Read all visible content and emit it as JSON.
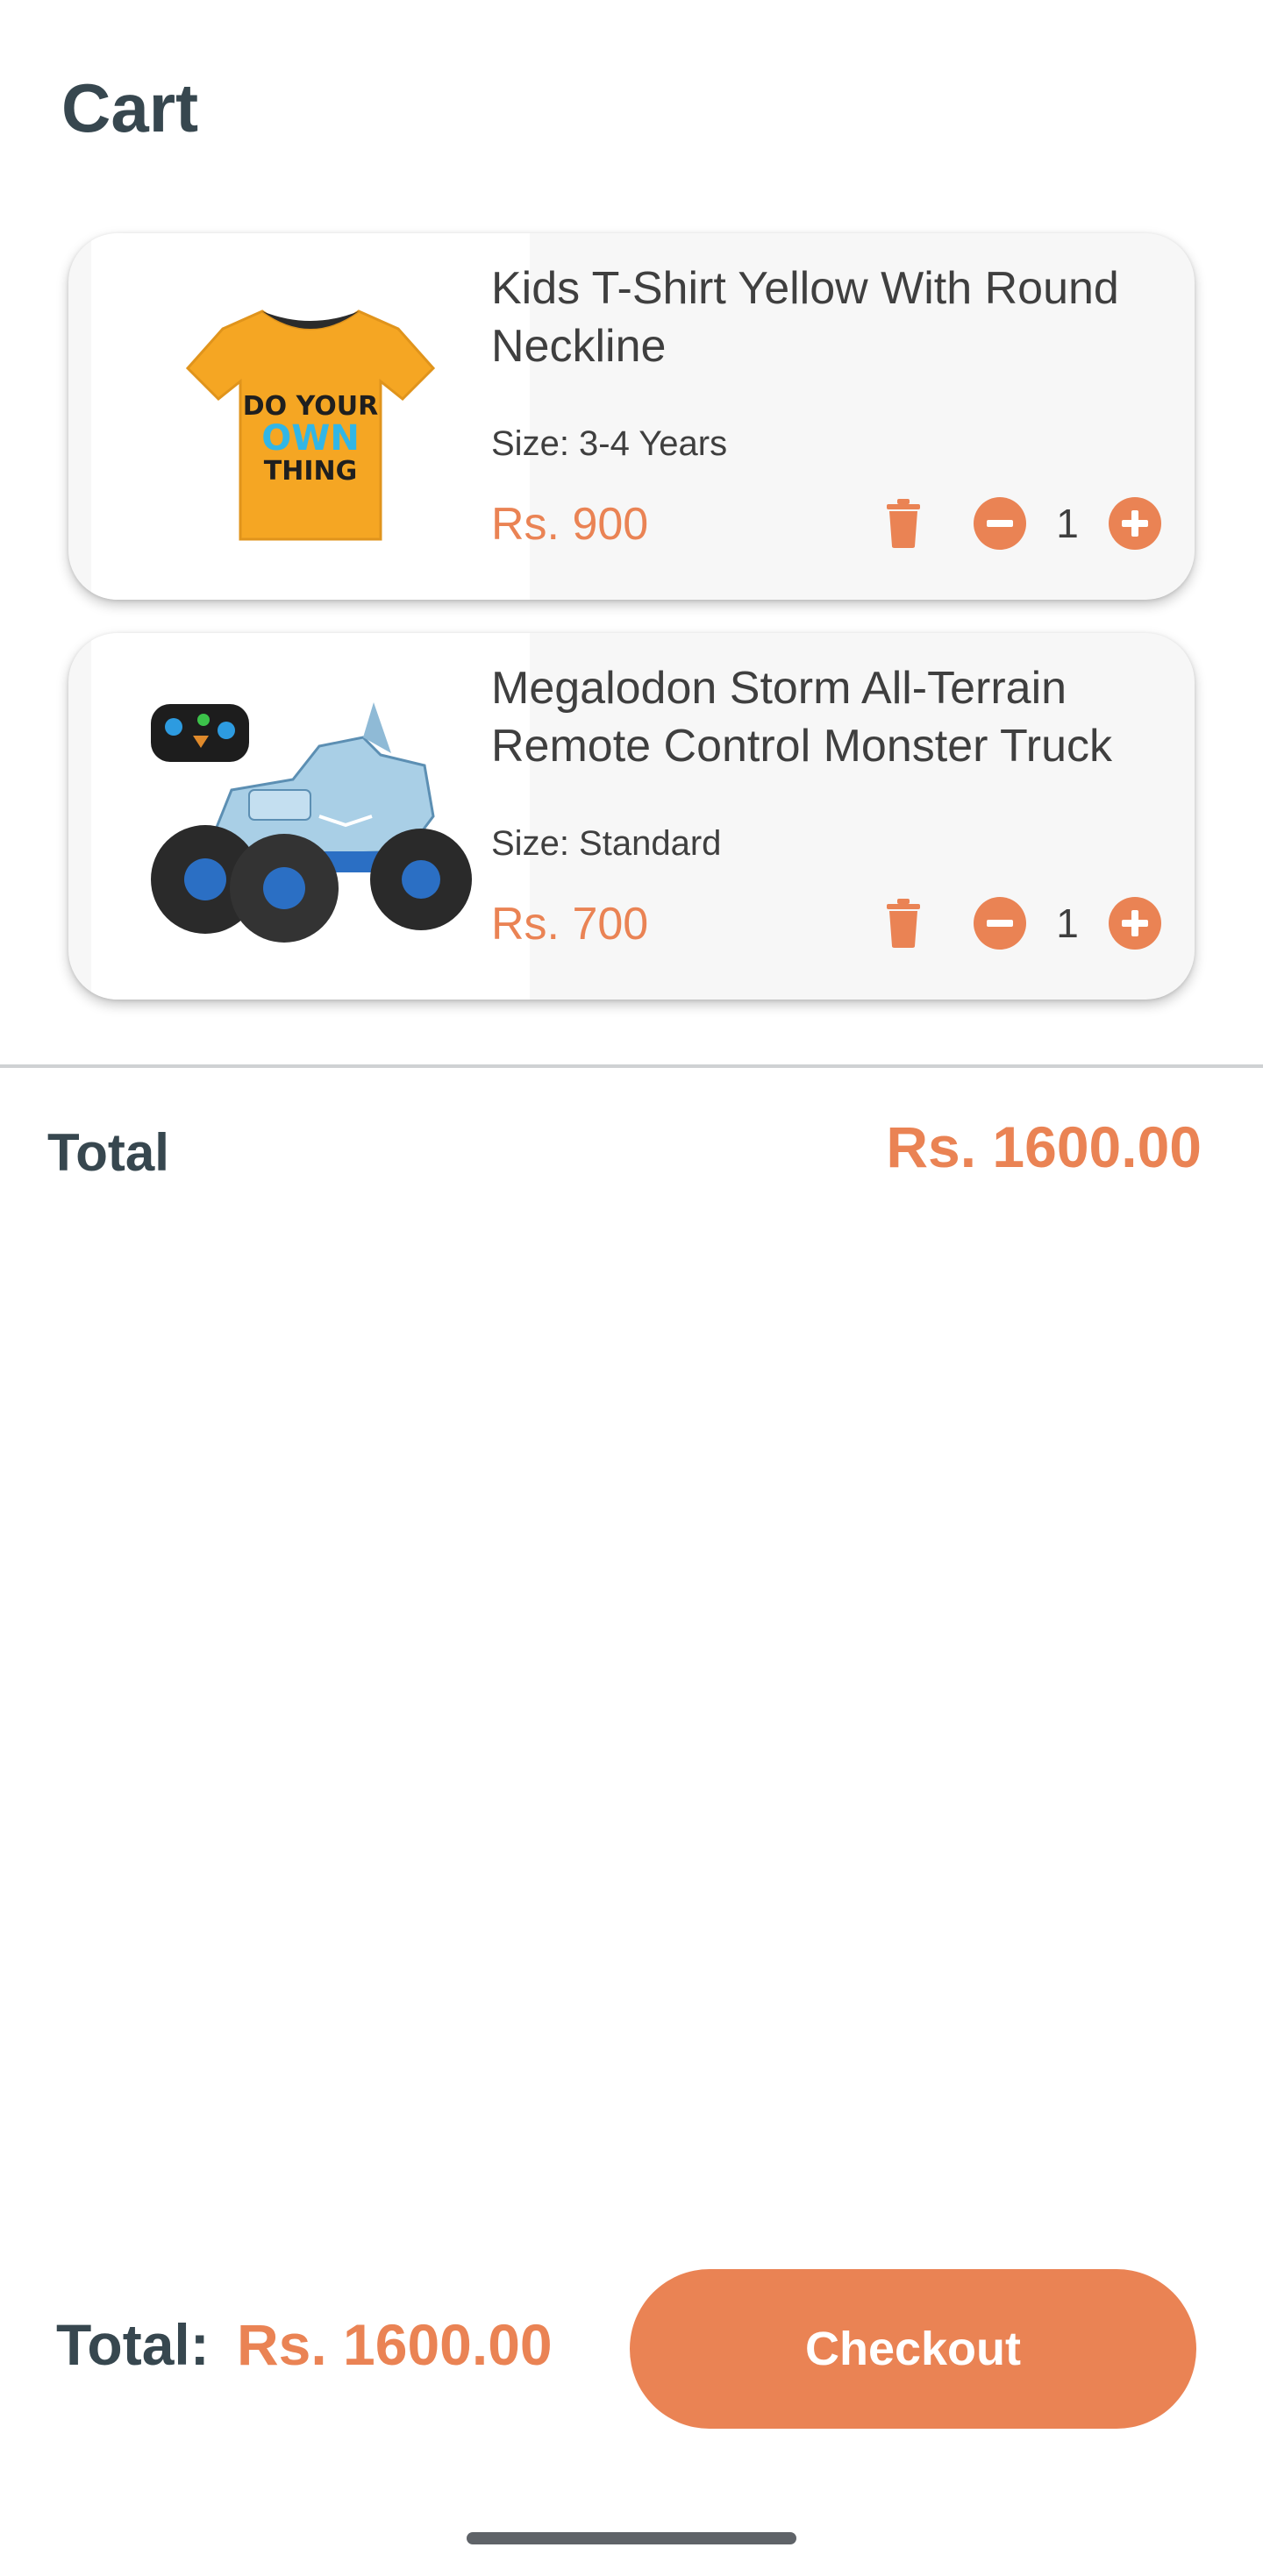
{
  "app": {
    "title": "Cart"
  },
  "colors": {
    "accent": "#ea8354",
    "text_dark": "#37474f",
    "card_bg": "#f7f7f7"
  },
  "cart": {
    "items": [
      {
        "name": "Kids T-Shirt Yellow With Round Neckline",
        "size": "Size: 3-4 Years",
        "price": "Rs. 900",
        "quantity": "1",
        "image_icon": "yellow-tshirt-image",
        "image_text": [
          "DO YOUR",
          "OWN",
          "THING"
        ]
      },
      {
        "name": "Megalodon Storm All-Terrain Remote Control Monster Truck",
        "size": "Size: Standard",
        "price": "Rs. 700",
        "quantity": "1",
        "image_icon": "monster-truck-image"
      }
    ],
    "icons": {
      "delete": "trash-icon",
      "decrease": "minus-circle-icon",
      "increase": "plus-circle-icon"
    }
  },
  "summary": {
    "total_label": "Total",
    "total_value": "Rs. 1600.00"
  },
  "footer": {
    "total_label": "Total:",
    "total_value": "Rs. 1600.00",
    "checkout_label": "Checkout"
  }
}
